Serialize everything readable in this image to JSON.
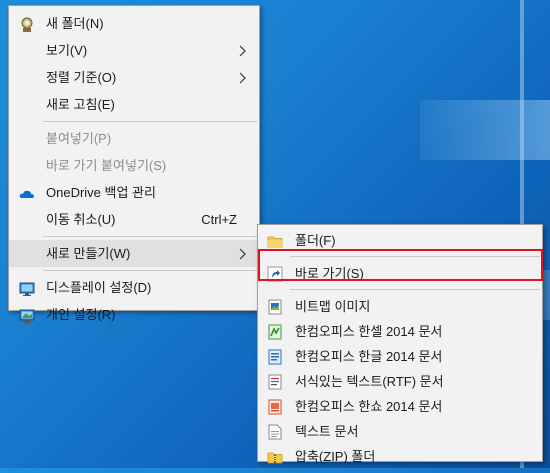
{
  "main_menu": {
    "items": [
      {
        "label": "새 폴더(N)",
        "icon": "new-folder-icon"
      },
      {
        "label": "보기(V)",
        "submenu": true
      },
      {
        "label": "정렬 기준(O)",
        "submenu": true
      },
      {
        "label": "새로 고침(E)"
      },
      {
        "label": "붙여넣기(P)",
        "disabled": true
      },
      {
        "label": "바로 가기 붙여넣기(S)",
        "disabled": true
      },
      {
        "label": "OneDrive 백업 관리",
        "icon": "onedrive-cloud-icon"
      },
      {
        "label": "이동 취소(U)",
        "shortcut": "Ctrl+Z"
      },
      {
        "label": "새로 만들기(W)",
        "submenu": true,
        "hover": true
      },
      {
        "label": "디스플레이 설정(D)",
        "icon": "display-settings-icon"
      },
      {
        "label": "개인 설정(R)",
        "icon": "personalize-icon"
      }
    ]
  },
  "sub_menu": {
    "items": [
      {
        "label": "폴더(F)",
        "icon": "folder-icon"
      },
      {
        "label": "바로 가기(S)",
        "icon": "shortcut-icon",
        "highlighted": true
      },
      {
        "label": "비트맵 이미지",
        "icon": "bitmap-icon"
      },
      {
        "label": "한컴오피스 한셀 2014 문서",
        "icon": "hancell-icon"
      },
      {
        "label": "한컴오피스 한글 2014 문서",
        "icon": "hangul-icon"
      },
      {
        "label": "서식있는 텍스트(RTF) 문서",
        "icon": "rtf-document-icon"
      },
      {
        "label": "한컴오피스 한쇼 2014 문서",
        "icon": "hanshow-icon"
      },
      {
        "label": "텍스트 문서",
        "icon": "text-document-icon"
      },
      {
        "label": "압축(ZIP) 폴더",
        "icon": "zip-folder-icon"
      }
    ]
  },
  "colors": {
    "menu_bg": "#f2f2f2",
    "hover_bg": "#e0e0e0",
    "highlight_border": "#e0141e",
    "desktop_blue": "#1a7fcf"
  }
}
